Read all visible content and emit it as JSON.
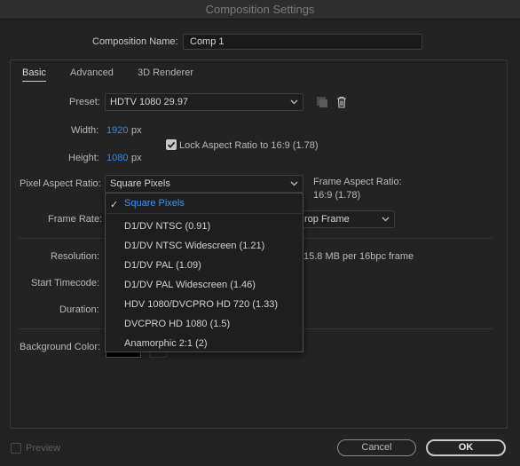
{
  "window": {
    "title": "Composition Settings"
  },
  "comp_name": {
    "label": "Composition Name:",
    "value": "Comp 1"
  },
  "tabs": [
    {
      "label": "Basic",
      "active": true
    },
    {
      "label": "Advanced",
      "active": false
    },
    {
      "label": "3D Renderer",
      "active": false
    }
  ],
  "preset": {
    "label": "Preset:",
    "value": "HDTV 1080 29.97",
    "save_icon": "save-preset-icon",
    "delete_icon": "trash-icon"
  },
  "width": {
    "label": "Width:",
    "value": "1920",
    "unit": "px"
  },
  "height": {
    "label": "Height:",
    "value": "1080",
    "unit": "px"
  },
  "lock_aspect": {
    "label": "Lock Aspect Ratio to 16:9 (1.78)",
    "checked": true
  },
  "pixel_aspect": {
    "label": "Pixel Aspect Ratio:",
    "value": "Square Pixels"
  },
  "frame_aspect": {
    "label": "Frame Aspect Ratio:",
    "value": "16:9 (1.78)"
  },
  "frame_rate": {
    "label": "Frame Rate:",
    "drop_frame_value": "rop Frame"
  },
  "resolution": {
    "label": "Resolution:",
    "info": "15.8 MB per 16bpc frame"
  },
  "start_timecode": {
    "label": "Start Timecode:"
  },
  "duration": {
    "label": "Duration:"
  },
  "background_color": {
    "label": "Background Color:",
    "color": "#000000"
  },
  "dropdown": {
    "items": [
      {
        "label": "Square Pixels",
        "selected": true
      },
      {
        "label": "D1/DV NTSC (0.91)",
        "selected": false
      },
      {
        "label": "D1/DV NTSC Widescreen (1.21)",
        "selected": false
      },
      {
        "label": "D1/DV PAL (1.09)",
        "selected": false
      },
      {
        "label": "D1/DV PAL Widescreen (1.46)",
        "selected": false
      },
      {
        "label": "HDV 1080/DVCPRO HD 720 (1.33)",
        "selected": false
      },
      {
        "label": "DVCPRO HD 1080 (1.5)",
        "selected": false
      },
      {
        "label": "Anamorphic 2:1 (2)",
        "selected": false
      }
    ]
  },
  "footer": {
    "preview_label": "Preview",
    "preview_checked": false,
    "cancel_label": "Cancel",
    "ok_label": "OK"
  },
  "colors": {
    "accent": "#2d8ceb",
    "background": "#232323"
  }
}
